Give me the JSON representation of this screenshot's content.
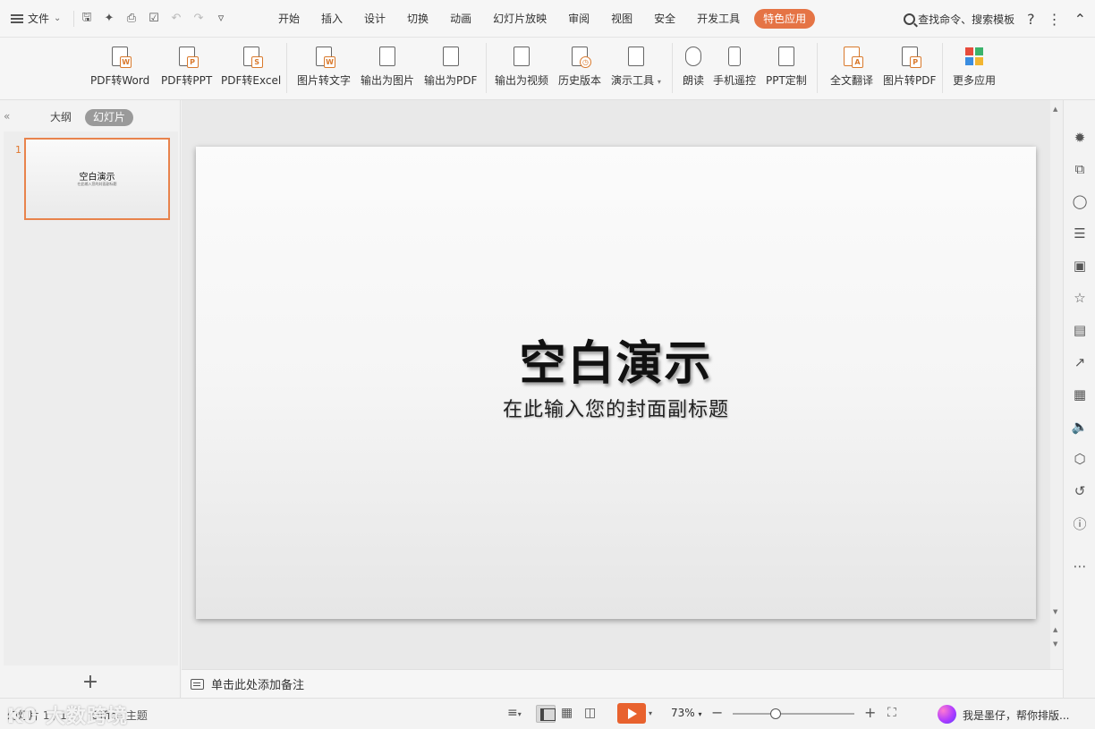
{
  "menubar": {
    "file_label": "文件",
    "tabs": [
      "开始",
      "插入",
      "设计",
      "切换",
      "动画",
      "幻灯片放映",
      "审阅",
      "视图",
      "安全",
      "开发工具"
    ],
    "special_tab": "特色应用",
    "search_label": "查找命令、搜索模板"
  },
  "ribbon": {
    "buttons": [
      {
        "label": "PDF转Word",
        "icon": "pdf-to-word-icon"
      },
      {
        "label": "PDF转PPT",
        "icon": "pdf-to-ppt-icon"
      },
      {
        "label": "PDF转Excel",
        "icon": "pdf-to-excel-icon"
      },
      {
        "label": "图片转文字",
        "icon": "image-to-text-icon"
      },
      {
        "label": "输出为图片",
        "icon": "export-image-icon"
      },
      {
        "label": "输出为PDF",
        "icon": "export-pdf-icon"
      },
      {
        "label": "输出为视频",
        "icon": "export-video-icon"
      },
      {
        "label": "历史版本",
        "icon": "history-version-icon"
      },
      {
        "label": "演示工具",
        "icon": "presentation-tools-icon"
      },
      {
        "label": "朗读",
        "icon": "read-aloud-icon"
      },
      {
        "label": "手机遥控",
        "icon": "phone-remote-icon"
      },
      {
        "label": "PPT定制",
        "icon": "ppt-custom-icon"
      },
      {
        "label": "全文翻译",
        "icon": "translate-icon"
      },
      {
        "label": "图片转PDF",
        "icon": "image-to-pdf-icon"
      },
      {
        "label": "更多应用",
        "icon": "more-apps-icon"
      }
    ]
  },
  "left_panel": {
    "tab_outline": "大纲",
    "tab_slides": "幻灯片",
    "thumbnail_number": "1",
    "thumbnail_title": "空白演示",
    "thumbnail_subtitle": "在此输入您的封面副标题"
  },
  "slide": {
    "title": "空白演示",
    "subtitle": "在此输入您的封面副标题"
  },
  "notes": {
    "placeholder": "单击此处添加备注"
  },
  "statusbar": {
    "slide_count": "幻灯片 1 / 1",
    "theme": "Office 主题",
    "watermark": "K0 大数跨境",
    "zoom": "73%",
    "zoom_fraction": 0.35,
    "assistant_text": "我是墨仔，帮你排版..."
  },
  "colors": {
    "accent": "#e57445",
    "play": "#e8622e",
    "thumbnail_border": "#e8834c"
  }
}
